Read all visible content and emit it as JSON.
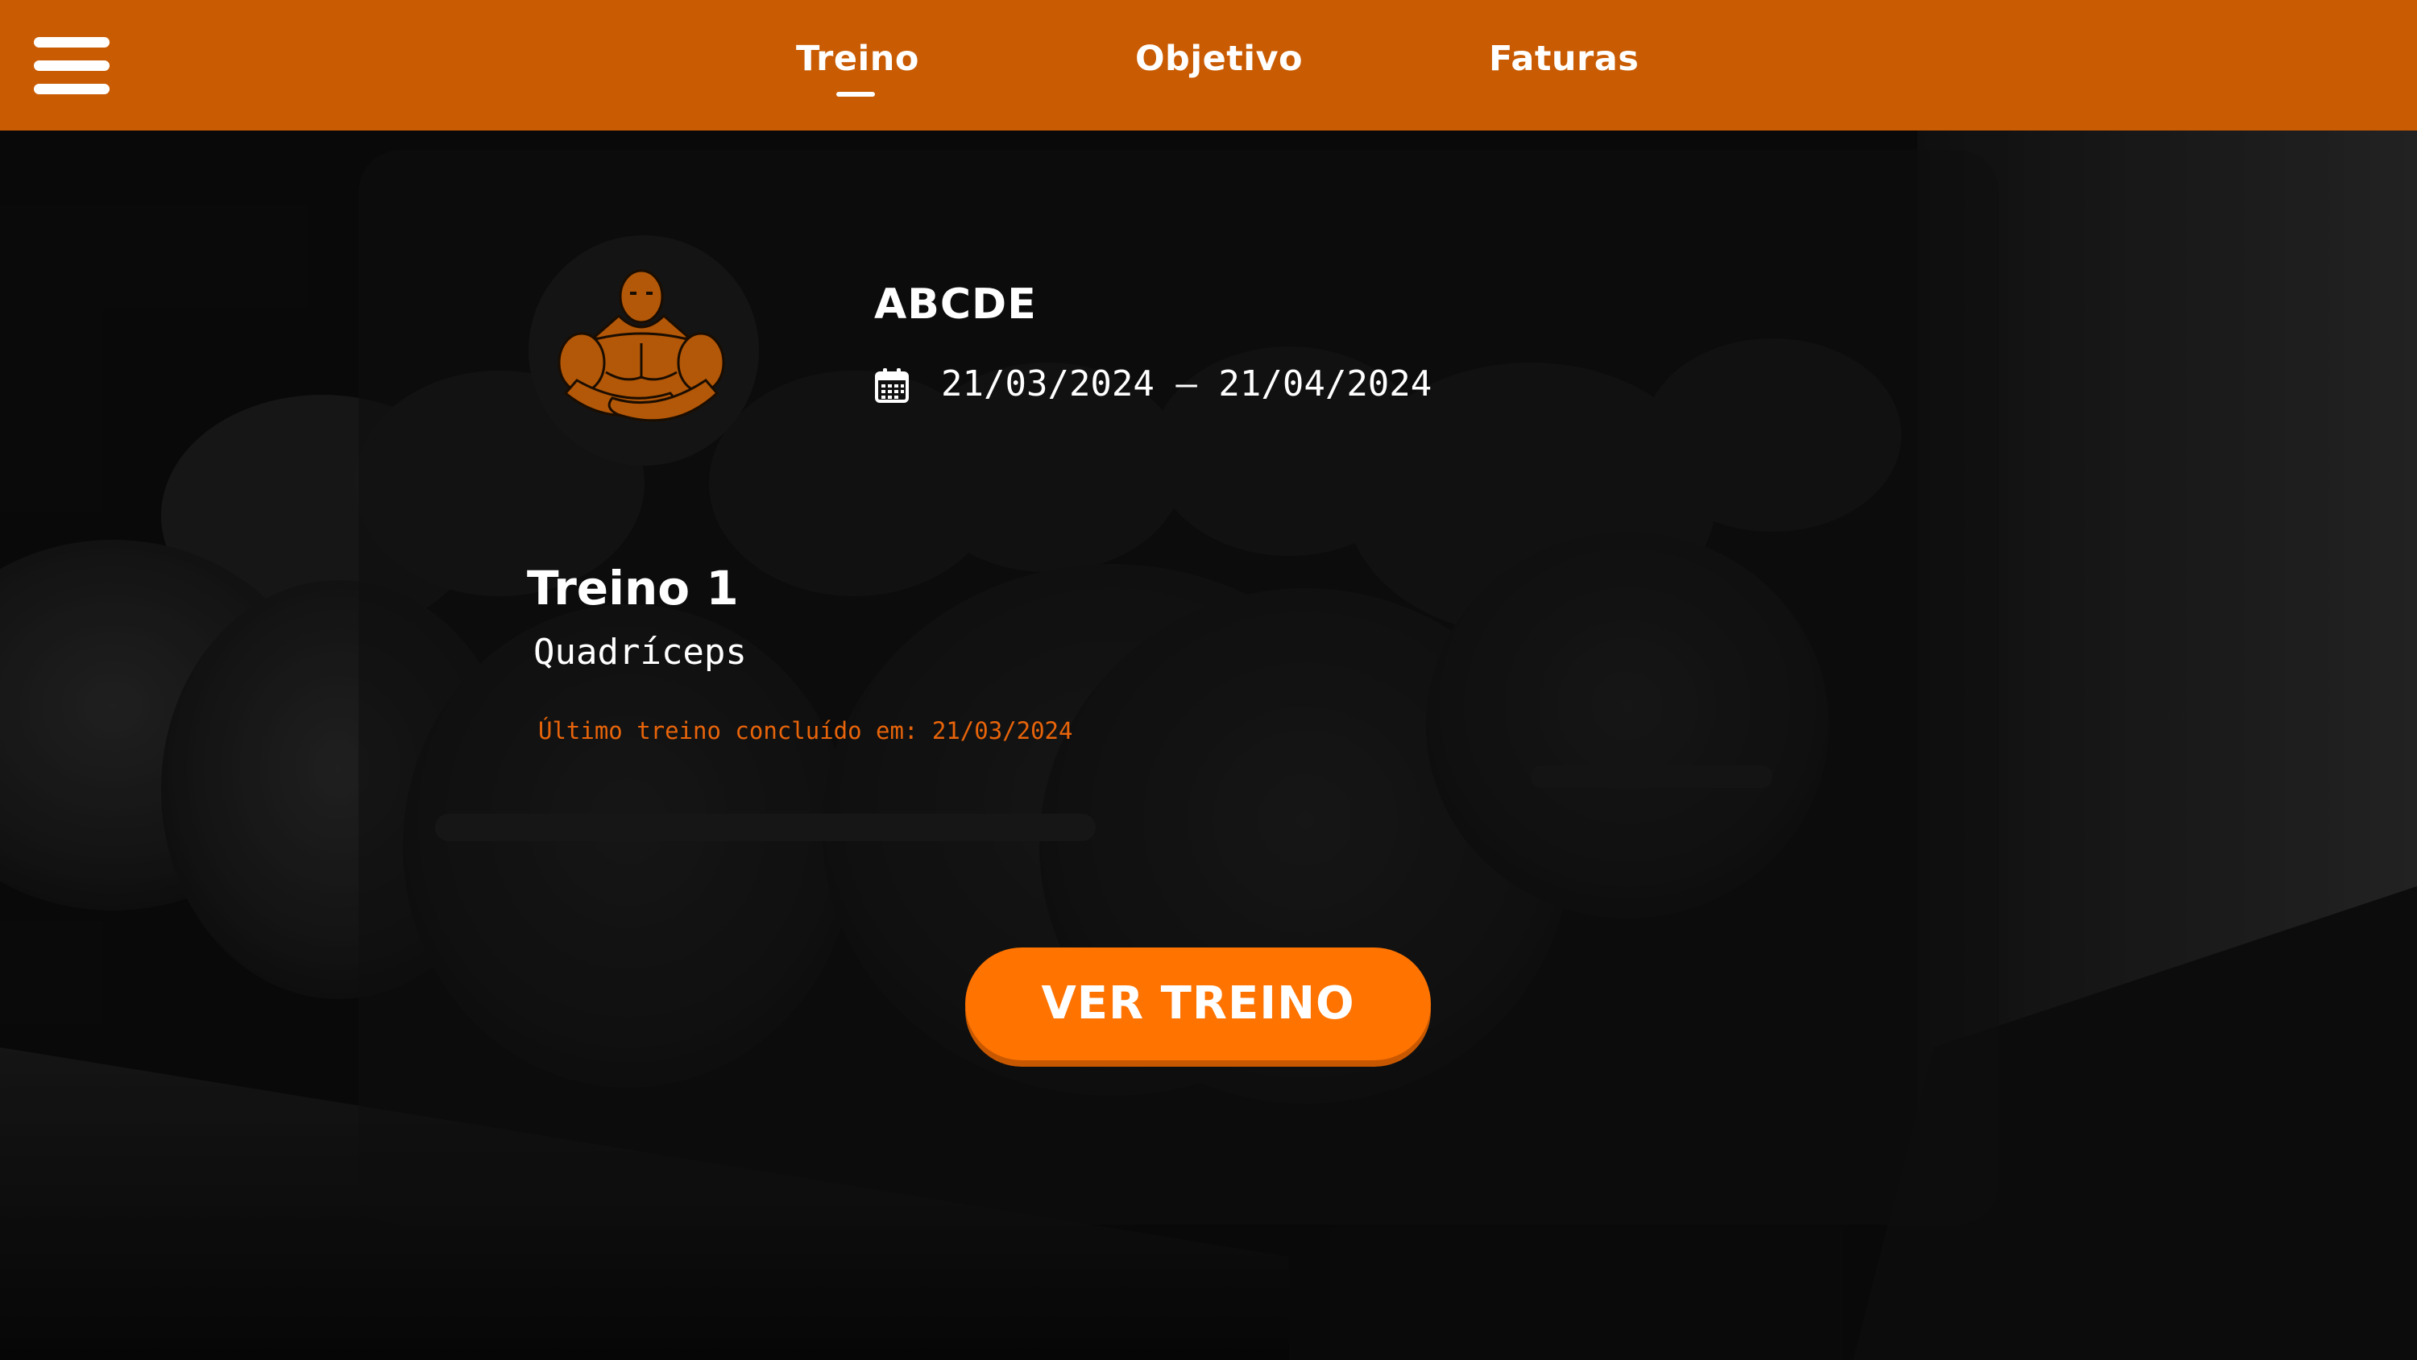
{
  "nav": {
    "menu_icon": "hamburger-menu-icon",
    "tabs": [
      {
        "label": "Treino",
        "active": true
      },
      {
        "label": "Objetivo",
        "active": false
      },
      {
        "label": "Faturas",
        "active": false
      }
    ]
  },
  "plan": {
    "avatar_icon": "bodybuilder-icon",
    "title": "ABCDE",
    "calendar_icon": "calendar-icon",
    "date_range": "21/03/2024 – 21/04/2024"
  },
  "workout": {
    "name": "Treino 1",
    "muscle_group": "Quadríceps",
    "last_completed": "Último treino concluído em: 21/03/2024"
  },
  "cta": {
    "label": "VER TREINO"
  },
  "colors": {
    "topbar": "#c95b02",
    "accent": "#ff7300",
    "accent_text": "#e8640a",
    "background": "#0b0b0b"
  }
}
